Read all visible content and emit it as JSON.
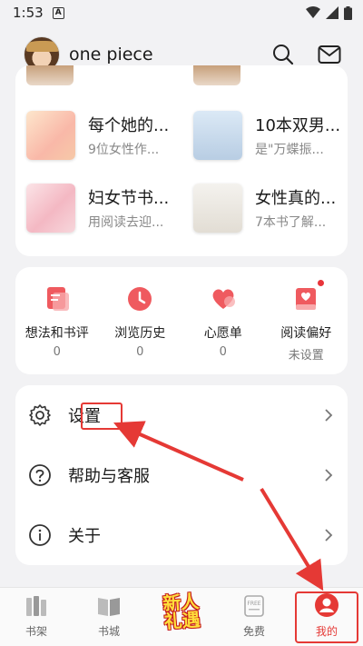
{
  "status_bar": {
    "time": "1:53",
    "notification_glyph": "A"
  },
  "header": {
    "username": "one piece",
    "icons": [
      "search-icon",
      "mail-icon"
    ]
  },
  "books": [
    {
      "title": "每个她的...",
      "subtitle": "9位女性作..."
    },
    {
      "title": "10本双男...",
      "subtitle": "是\"万蝶振..."
    },
    {
      "title": "妇女节书...",
      "subtitle": "用阅读去迎..."
    },
    {
      "title": "女性真的...",
      "subtitle": "7本书了解..."
    }
  ],
  "stats": [
    {
      "label": "想法和书评",
      "value": "0",
      "icon": "note-icon"
    },
    {
      "label": "浏览历史",
      "value": "0",
      "icon": "clock-icon"
    },
    {
      "label": "心愿单",
      "value": "0",
      "icon": "heart-icon"
    },
    {
      "label": "阅读偏好",
      "value": "未设置",
      "icon": "book-heart-icon"
    }
  ],
  "menu": [
    {
      "label": "设置",
      "icon": "gear-icon"
    },
    {
      "label": "帮助与客服",
      "icon": "help-icon"
    },
    {
      "label": "关于",
      "icon": "info-icon"
    }
  ],
  "bottom_nav": {
    "items": [
      {
        "label": "书架",
        "icon": "bookshelf-icon"
      },
      {
        "label": "书城",
        "icon": "bookstore-icon"
      },
      {
        "label": "",
        "promo": "新人\n礼遇"
      },
      {
        "label": "免费",
        "icon": "free-icon"
      },
      {
        "label": "我的",
        "icon": "profile-icon"
      }
    ],
    "active": "我的"
  },
  "colors": {
    "accent": "#e53935",
    "background": "#f2f2f4",
    "card": "#ffffff"
  }
}
